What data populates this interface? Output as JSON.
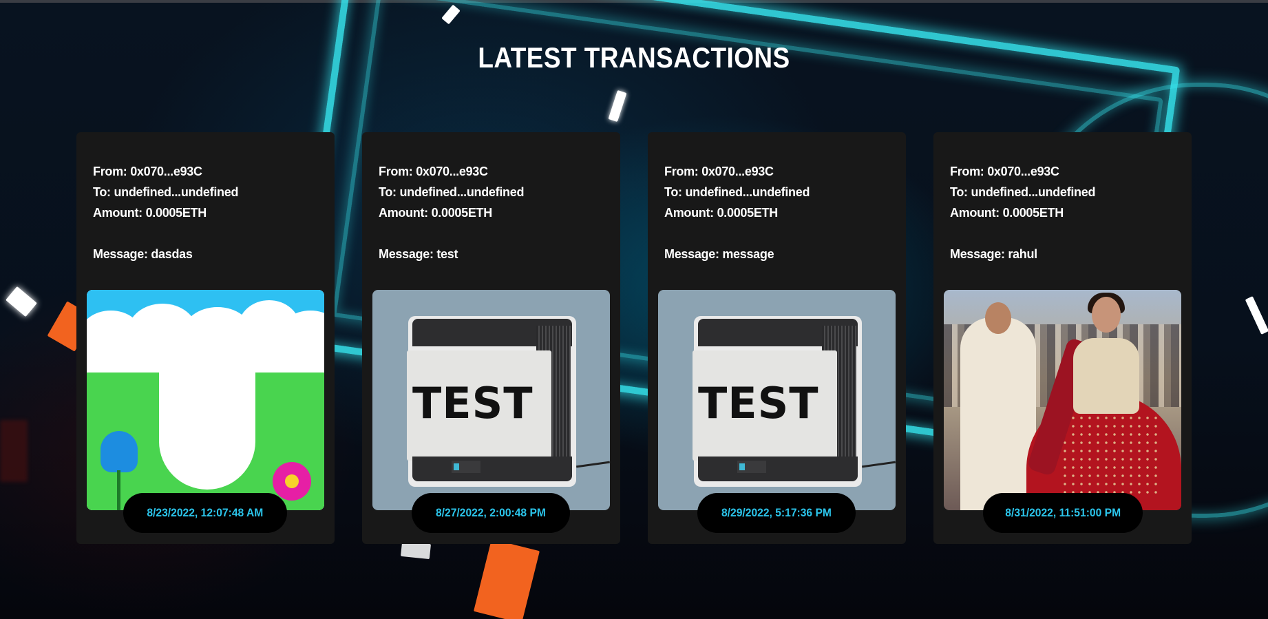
{
  "page": {
    "title": "LATEST TRANSACTIONS"
  },
  "colors": {
    "card_background": "#181818",
    "timestamp_text": "#2bc4ea",
    "neon_accent": "#37e6ef",
    "title_text": "#ffffff"
  },
  "transactions": [
    {
      "from": "From: 0x070...e93C",
      "to": "To: undefined...undefined",
      "amount": "Amount: 0.0005ETH",
      "message": "Message: dasdas",
      "timestamp": "8/23/2022, 12:07:48 AM",
      "gif": "celebration-cartoon-gif"
    },
    {
      "from": "From: 0x070...e93C",
      "to": "To: undefined...undefined",
      "amount": "Amount: 0.0005ETH",
      "message": "Message: test",
      "timestamp": "8/27/2022, 2:00:48 PM",
      "gif": "printer-test-gif",
      "gif_text": "TEST"
    },
    {
      "from": "From: 0x070...e93C",
      "to": "To: undefined...undefined",
      "amount": "Amount: 0.0005ETH",
      "message": "Message: message",
      "timestamp": "8/29/2022, 5:17:36 PM",
      "gif": "printer-test-gif",
      "gif_text": "TEST"
    },
    {
      "from": "From: 0x070...e93C",
      "to": "To: undefined...undefined",
      "amount": "Amount: 0.0005ETH",
      "message": "Message: rahul",
      "timestamp": "8/31/2022, 11:51:00 PM",
      "gif": "dance-scene-gif"
    }
  ]
}
